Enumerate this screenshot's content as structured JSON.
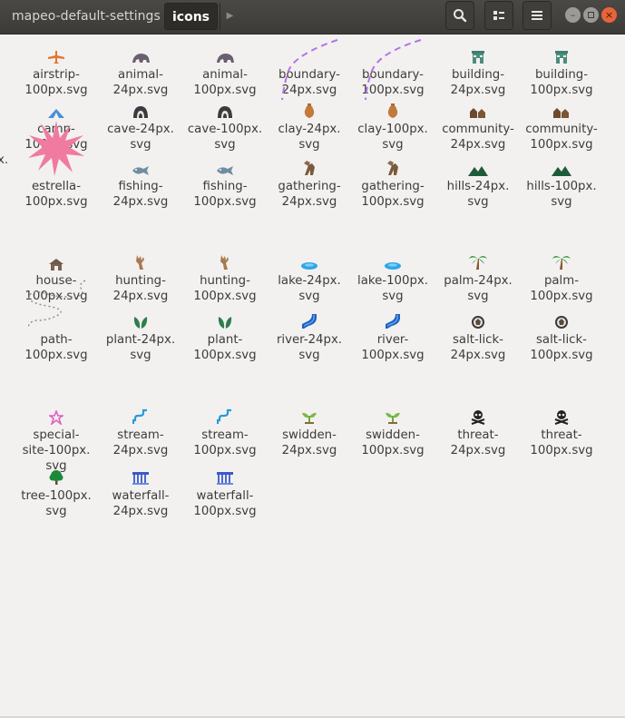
{
  "header": {
    "breadcrumb_parent": "mapeo-default-settings",
    "breadcrumb_current": "icons",
    "icons": {
      "next": "chevron-right-icon",
      "search": "search-icon",
      "view": "view-toggle-icon",
      "menu": "hamburger-menu-icon"
    },
    "window_buttons": [
      "minimize",
      "maximize",
      "close"
    ]
  },
  "files": [
    {
      "label": "airstrip-\n100px.svg",
      "icon": "airstrip"
    },
    {
      "label": "animal-\n24px.svg",
      "icon": "animal"
    },
    {
      "label": "animal-\n100px.svg",
      "icon": "animal"
    },
    {
      "label": "boundary-\n24px.svg",
      "icon": "boundary"
    },
    {
      "label": "boundary-\n100px.svg",
      "icon": "boundary"
    },
    {
      "label": "building-\n24px.svg",
      "icon": "building"
    },
    {
      "label": "building-\n100px.svg",
      "icon": "building"
    },
    {
      "label": "camp-\n100px.svg",
      "icon": "camp"
    },
    {
      "label": "cave-24px.\nsvg",
      "icon": "cave"
    },
    {
      "label": "cave-100px.\nsvg",
      "icon": "cave"
    },
    {
      "label": "clay-24px.\nsvg",
      "icon": "clay"
    },
    {
      "label": "clay-100px.\nsvg",
      "icon": "clay"
    },
    {
      "label": "community-\n24px.svg",
      "icon": "community"
    },
    {
      "label": "community-\n100px.svg",
      "icon": "community"
    },
    {
      "label": "estrella-\n100px.svg",
      "icon": "estrella"
    },
    {
      "label": "fishing-\n24px.svg",
      "icon": "fishing"
    },
    {
      "label": "fishing-\n100px.svg",
      "icon": "fishing"
    },
    {
      "label": "gathering-\n24px.svg",
      "icon": "gathering"
    },
    {
      "label": "gathering-\n100px.svg",
      "icon": "gathering"
    },
    {
      "label": "hills-24px.\nsvg",
      "icon": "hills"
    },
    {
      "label": "hills-100px.\nsvg",
      "icon": "hills"
    },
    {
      "label": "house-\n100px.svg",
      "icon": "house"
    },
    {
      "label": "hunting-\n24px.svg",
      "icon": "hunting"
    },
    {
      "label": "hunting-\n100px.svg",
      "icon": "hunting"
    },
    {
      "label": "lake-24px.\nsvg",
      "icon": "lake"
    },
    {
      "label": "lake-100px.\nsvg",
      "icon": "lake"
    },
    {
      "label": "palm-24px.\nsvg",
      "icon": "palm"
    },
    {
      "label": "palm-\n100px.svg",
      "icon": "palm"
    },
    {
      "label": "path-\n100px.svg",
      "icon": "path"
    },
    {
      "label": "plant-24px.\nsvg",
      "icon": "plant"
    },
    {
      "label": "plant-\n100px.svg",
      "icon": "plant"
    },
    {
      "label": "river-24px.\nsvg",
      "icon": "river"
    },
    {
      "label": "river-\n100px.svg",
      "icon": "river"
    },
    {
      "label": "salt-lick-\n24px.svg",
      "icon": "salt-lick"
    },
    {
      "label": "salt-lick-\n100px.svg",
      "icon": "salt-lick"
    },
    {
      "label": "special-\nsite-100px.\nsvg",
      "icon": "special-site"
    },
    {
      "label": "stream-\n24px.svg",
      "icon": "stream"
    },
    {
      "label": "stream-\n100px.svg",
      "icon": "stream"
    },
    {
      "label": "swidden-\n24px.svg",
      "icon": "swidden"
    },
    {
      "label": "swidden-\n100px.svg",
      "icon": "swidden"
    },
    {
      "label": "threat-\n24px.svg",
      "icon": "threat"
    },
    {
      "label": "threat-\n100px.svg",
      "icon": "threat"
    },
    {
      "label": "tree-100px.\nsvg",
      "icon": "tree"
    },
    {
      "label": "waterfall-\n24px.svg",
      "icon": "waterfall"
    },
    {
      "label": "waterfall-\n100px.svg",
      "icon": "waterfall"
    }
  ],
  "partial_left_labels": [
    "",
    "x.\n",
    "",
    "",
    ".\n",
    "",
    ""
  ]
}
